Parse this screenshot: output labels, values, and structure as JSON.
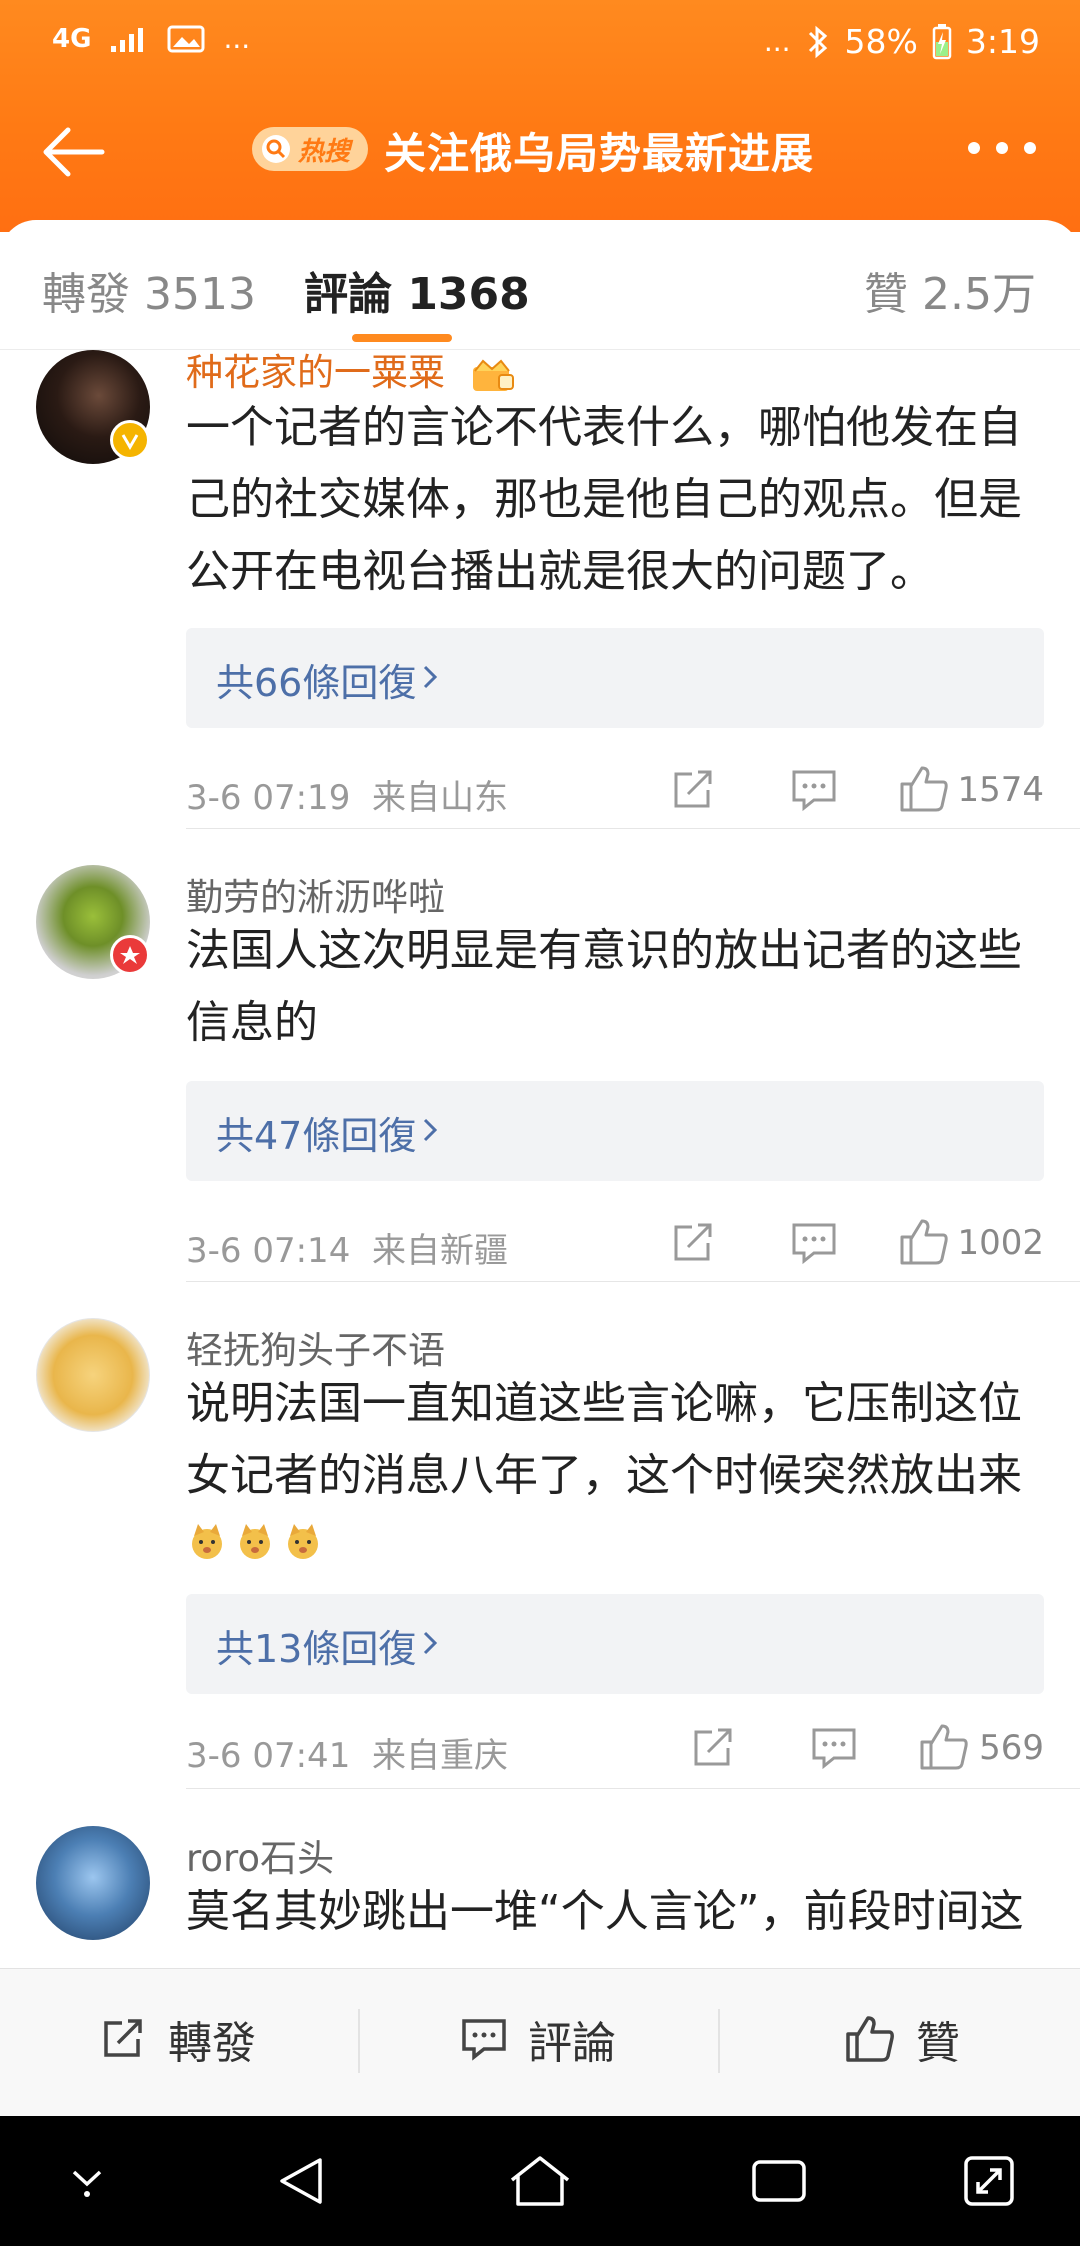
{
  "status": {
    "network": "4G",
    "dots_left": "...",
    "dots_right": "...",
    "battery": "58%",
    "time": "3:19"
  },
  "nav": {
    "hot_label": "热搜",
    "title": "关注俄乌局势最新进展"
  },
  "tabs": {
    "repost": "轉發 3513",
    "comments": "評論 1368",
    "likes": "贊 2.5万"
  },
  "comments": [
    {
      "user": "种花家的一粟粟",
      "text": "一个记者的言论不代表什么，哪怕他发在自己的社交媒体，那也是他自己的观点。但是公开在电视台播出就是很大的问题了。",
      "replies": "共66條回復",
      "time": "3-6 07:19",
      "location": "来自山东",
      "likes": "1574"
    },
    {
      "user": "勤劳的淅沥哗啦",
      "text": "法国人这次明显是有意识的放出记者的这些信息的",
      "replies": "共47條回復",
      "time": "3-6 07:14",
      "location": "来自新疆",
      "likes": "1002"
    },
    {
      "user": "轻抚狗头子不语",
      "text": "说明法国一直知道这些言论嘛，它压制这位女记者的消息八年了，这个时候突然放出来",
      "replies": "共13條回復",
      "time": "3-6 07:41",
      "location": "来自重庆",
      "likes": "569"
    },
    {
      "user": "roro石头",
      "text": "莫名其妙跳出一堆“个人言论”，前段时间这"
    }
  ],
  "actions": {
    "repost": "轉發",
    "comment": "評論",
    "like": "贊"
  },
  "colors": {
    "accent": "#ff7a14",
    "link": "#4d6fa8",
    "vip_name": "#e06b1a"
  }
}
